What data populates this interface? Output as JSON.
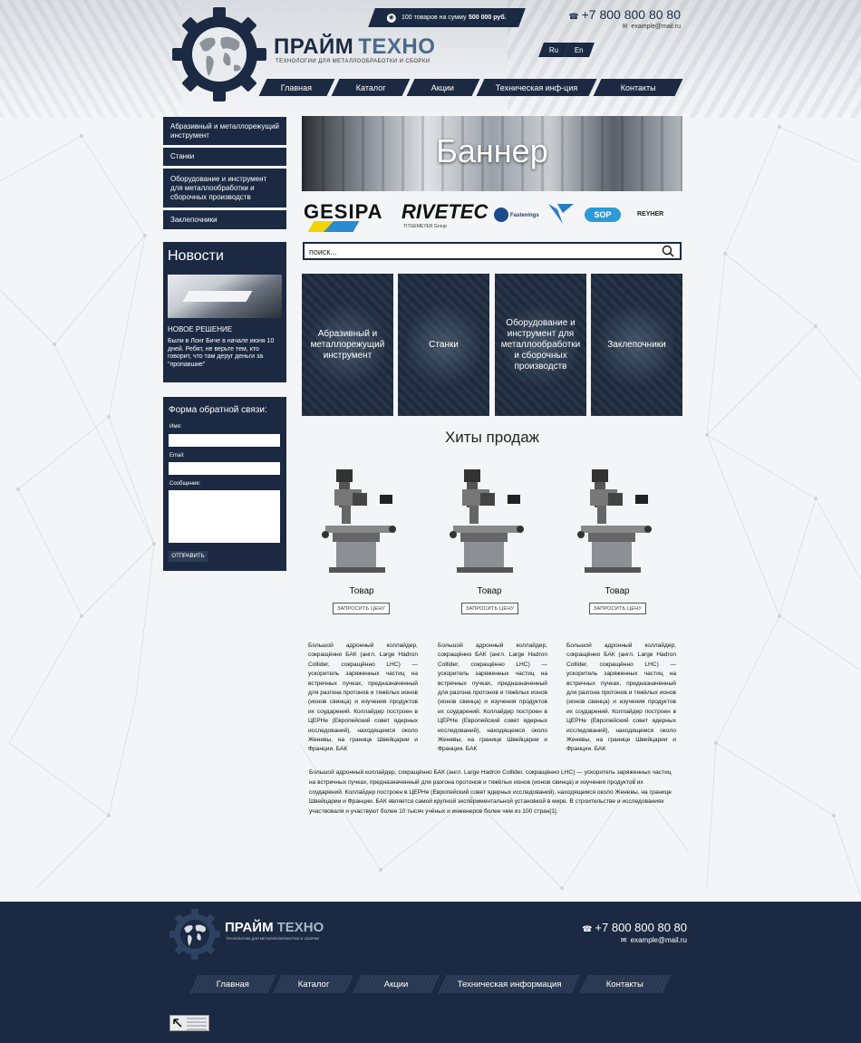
{
  "header": {
    "brand_part1": "ПРАЙМ",
    "brand_part2": "ТЕХНО",
    "tagline": "ТЕХНОЛОГИИ ДЛЯ МЕТАЛЛООБРАБОТКИ И СБОРКИ",
    "promo_text": "100 товаров на сумму",
    "promo_amount": "500 000 руб.",
    "phone": "+7 800 800 80 80",
    "email": "example@mail.ru",
    "lang_ru": "Ru",
    "lang_en": "En"
  },
  "nav": [
    "Главная",
    "Каталог",
    "Акции",
    "Техническая инф-ция",
    "Контакты"
  ],
  "sidebar": {
    "categories": [
      "Абразивный и металлорежущий инструмент",
      "Станки",
      "Оборудование и инструмент для металлообработки и сборочных производств",
      "Заклепочники"
    ],
    "news": {
      "title": "Новости",
      "headline": "НОВОЕ РЕШЕНИЕ",
      "text": "Были в Лонг Биче в начале июня 10 дней. Ребят, не верьте тем, кто говорит, что там деруг деньги за \"пропавшие\""
    },
    "form": {
      "title": "Форма обратной связи:",
      "name_label": "Имя:",
      "email_label": "Email:",
      "message_label": "Сообщение:",
      "submit_label": "ОТПРАВИТЬ"
    }
  },
  "main": {
    "banner_text": "Баннер",
    "brands": [
      "GESIPA",
      "RIVETEC",
      "TITGEMEYER Group",
      "Fastenings",
      "SOP",
      "REYHER"
    ],
    "search_placeholder": "поиск...",
    "tiles": [
      "Абразивный и металлорежущий инструмент",
      "Станки",
      "Оборудование и инструмент для металлообработки и сборочных производств",
      "Заклепочники"
    ],
    "hits_title": "Хиты продаж",
    "products": [
      {
        "name": "Товар",
        "button": "ЗАПРОСИТЬ ЦЕНУ"
      },
      {
        "name": "Товар",
        "button": "ЗАПРОСИТЬ ЦЕНУ"
      },
      {
        "name": "Товар",
        "button": "ЗАПРОСИТЬ ЦЕНУ"
      }
    ],
    "column_text": "Большой адронный коллайдер, сокращённо БАК (англ. Large Hadron Collider, сокращённо LHC) — ускоритель заряженных частиц на встречных пучках, предназначенный для разгона протонов и тяжёлых ионов (ионов свинца) и изучения продуктов их соударений. Коллайдер построен в ЦЕРНе (Европейский совет ядерных исследований), находящемся около Женевы, на границе Швейцарии и Франции. БАК",
    "long_text": "Большой адронный коллайдер, сокращённо БАК (англ. Large Hadron Collider, сокращённо LHC) — ускоритель заряженных частиц на встречных пучках, предназначенный для разгона протонов и тяжёлых ионов (ионов свинца) и изучения продуктов их соударений. Коллайдер построен в ЦЕРНе (Европейский совет ядерных исследований), находящемся около Женевы, на границе Швейцарии и Франции. БАК является самой крупной экспериментальной установкой в мире. В строительстве и исследованиях участвовали и участвуют более 10 тысяч учёных и инженеров более чем из 100 стран[1]."
  },
  "footer": {
    "brand_part1": "ПРАЙМ",
    "brand_part2": "ТЕХНО",
    "tagline": "ТЕХНОЛОГИИ ДЛЯ МЕТАЛЛООБРАБОТКИ И СБОРКИ",
    "phone": "+7 800 800 80 80",
    "email": "example@mail.ru",
    "nav": [
      "Главная",
      "Каталог",
      "Акции",
      "Техническая информация",
      "Контакты"
    ]
  },
  "colors": {
    "dark_navy": "#1b2a42",
    "accent_blue": "#4b6a8a"
  },
  "icons": [
    "gear-globe-logo",
    "phone-icon",
    "mail-icon",
    "search-icon",
    "counter-arrow-icon"
  ]
}
